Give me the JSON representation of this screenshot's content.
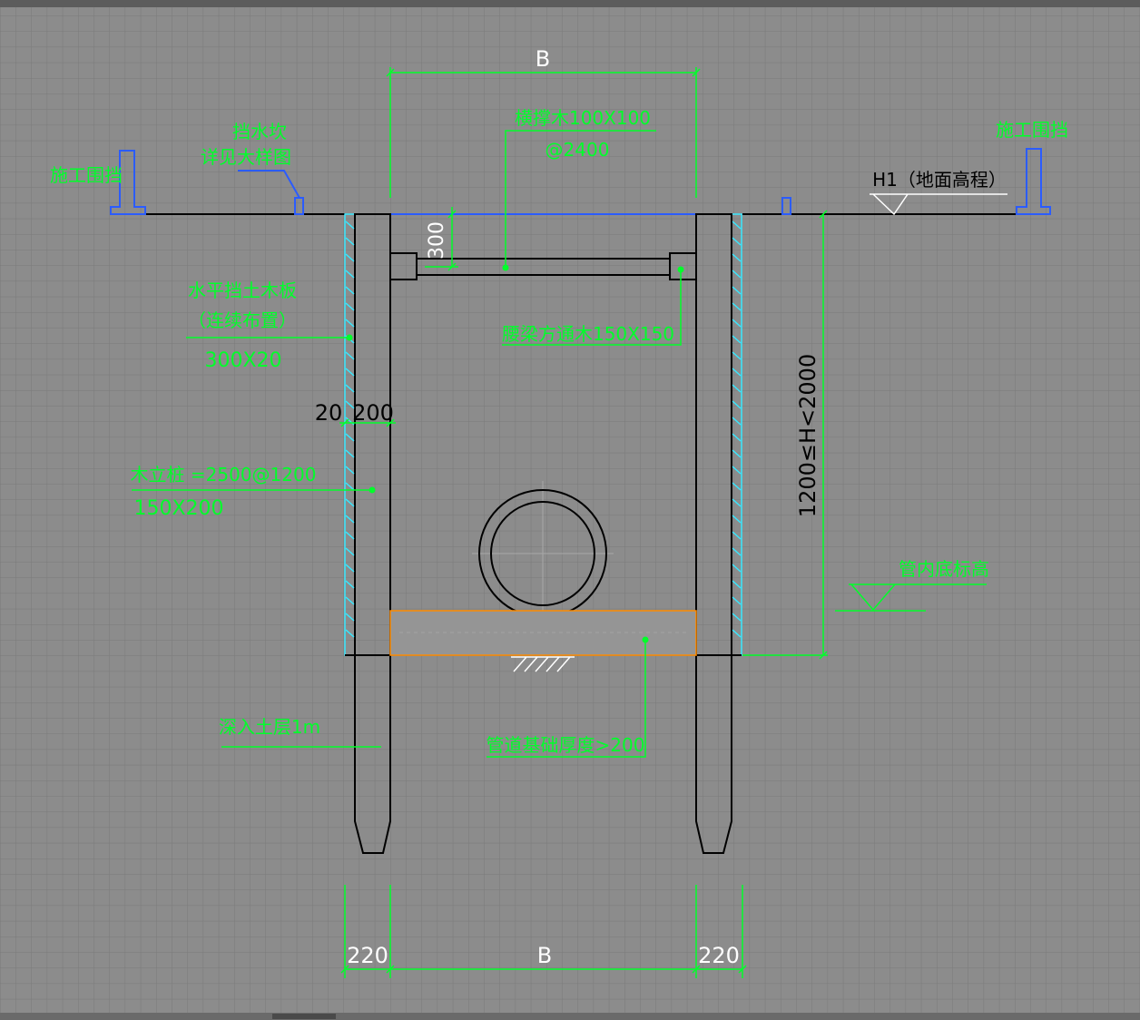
{
  "colors": {
    "background": "#8c8c8c",
    "grid": "#7a7a7a",
    "annotation": "#00ff2a",
    "barrier": "#2b5cff",
    "structure": "#000000",
    "board_hatch": "#38e8ff",
    "foundation": "#ff8c00"
  },
  "labels": {
    "width_top": "B",
    "cross_brace": "横撑木100X100",
    "cross_brace_spacing": "@2400",
    "barrier_left": "施工围挡",
    "barrier_right": "施工围挡",
    "water_stop_1": "挡水坎",
    "water_stop_2": "详见大样图",
    "ground_level": "H1（地面高程）",
    "depth_300": "300",
    "board_1": "水平挡土木板",
    "board_2": "（连续布置）",
    "board_3": "300X20",
    "waist_beam": "腰梁方通木150X150",
    "dim_20": "20",
    "dim_200": "200",
    "pile_1": "木立桩 =2500@1200",
    "pile_2": "150X200",
    "depth_range": "1200≤H<2000",
    "pipe_bottom": "管内底标高",
    "embed": "深入土层1m",
    "foundation": "管道基础厚度>200",
    "dim_left": "220",
    "width_bottom": "B",
    "dim_right": "220"
  }
}
